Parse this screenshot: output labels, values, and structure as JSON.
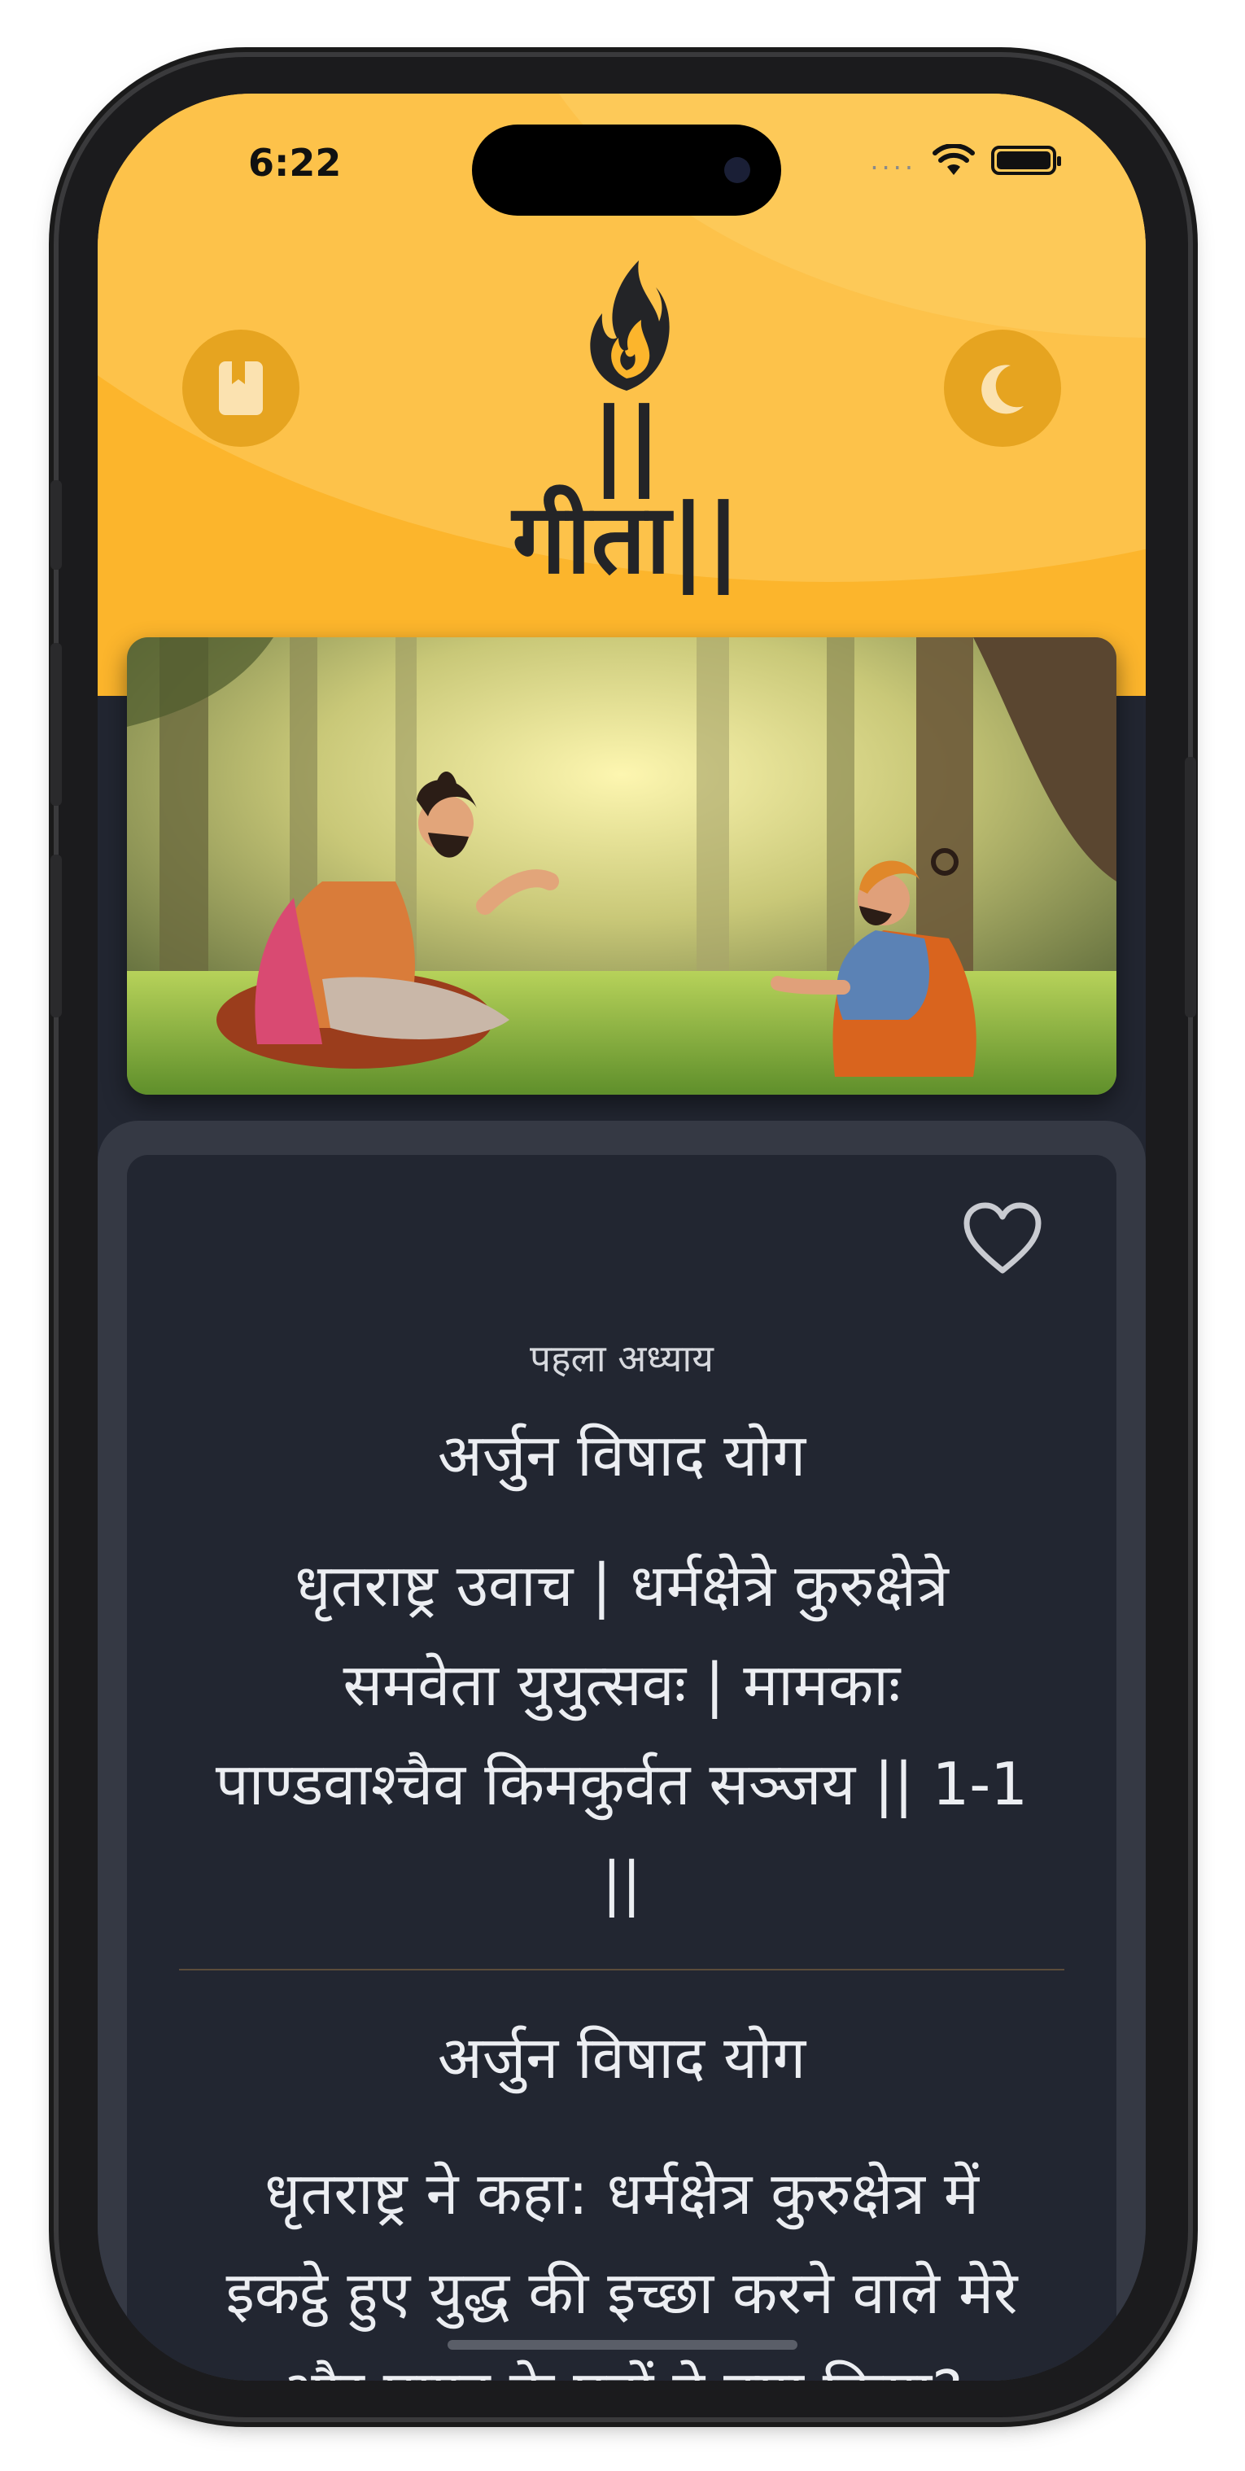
{
  "status_bar": {
    "time": "6:22",
    "signal": "....",
    "icons": [
      "wifi-icon",
      "battery-icon"
    ]
  },
  "header": {
    "logo_text": "||गीता||",
    "left_button_icon": "book-icon",
    "right_button_icon": "moon-icon",
    "accent_color": "#fcb52c"
  },
  "hero": {
    "illustration": "two-sages-in-forest"
  },
  "verse_card": {
    "favorite_icon": "heart-outline-icon",
    "chapter_label": "पहला अध्याय",
    "chapter_title": "अर्जुन विषाद योग",
    "verse_lines": [
      "धृतराष्ट्र उवाच | धर्मक्षेत्रे कुरुक्षेत्रे",
      "समवेता युयुत्सवः | मामकाः",
      "पाण्डवाश्चैव किमकुर्वत सञ्जय || 1-1",
      "||"
    ],
    "translation_title": "अर्जुन विषाद योग",
    "translation_lines": [
      "धृतराष्ट्र ने कहा: धर्मक्षेत्र कुरुक्षेत्र में",
      "इकट्ठे हुए युद्ध की इच्छा करने वाले मेरे",
      "और पाण्डु के पुत्रों ने क्या किया?"
    ]
  }
}
